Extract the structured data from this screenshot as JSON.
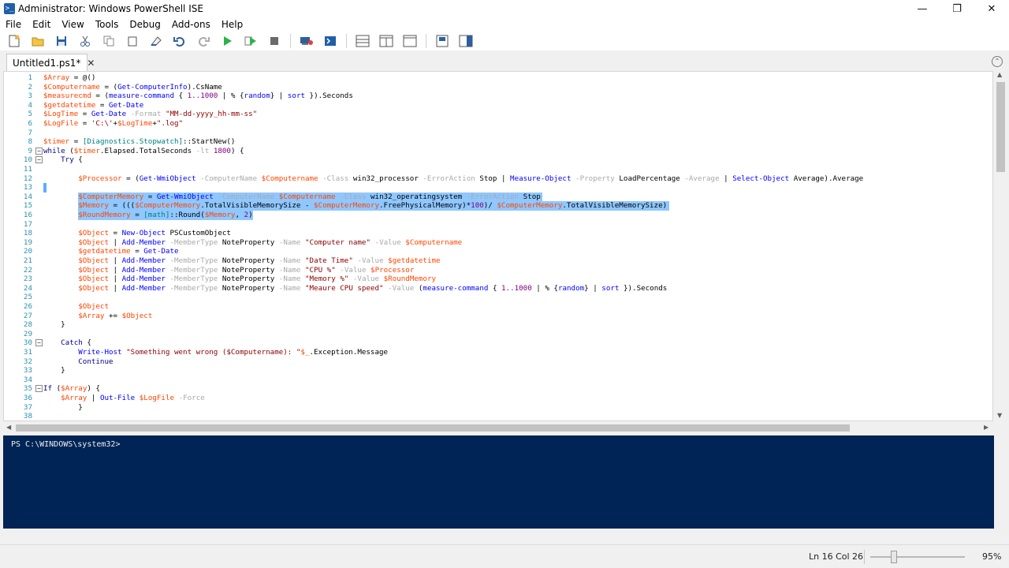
{
  "window": {
    "title": "Administrator: Windows PowerShell ISE",
    "icon_name": "powershell-ise-icon",
    "controls": [
      "minimize-icon",
      "restore-icon",
      "close-icon"
    ]
  },
  "menu": [
    "File",
    "Edit",
    "View",
    "Tools",
    "Debug",
    "Add-ons",
    "Help"
  ],
  "toolbar": {
    "buttons": [
      "new-file-icon",
      "open-file-icon",
      "save-icon",
      "cut-icon",
      "copy-icon",
      "paste-icon",
      "clear-console-icon",
      "undo-icon",
      "redo-icon",
      "run-script-icon",
      "run-selection-icon",
      "stop-icon",
      "remote-powershell-icon",
      "start-powershell-icon",
      "show-script-pane-top-icon",
      "show-script-pane-right-icon",
      "show-script-pane-max-icon",
      "show-command-window-icon",
      "show-command-addon-icon"
    ]
  },
  "tab": {
    "label": "Untitled1.ps1*"
  },
  "editor": {
    "lines": [
      "$Array = @()",
      "$Computername = (Get-ComputerInfo).CsName",
      "$measurecmd = (measure-command { 1..1000 | % {random} | sort }).Seconds",
      "$getdatetime = Get-Date",
      "$LogTime = Get-Date -Format \"MM-dd-yyyy_hh-mm-ss\"",
      "$LogFile = 'C:\\'+$LogTime+\".log\"",
      "",
      "$timer = [Diagnostics.Stopwatch]::StartNew()",
      "while ($timer.Elapsed.TotalSeconds -lt 1800) {",
      "    Try {",
      "",
      "        $Processor = (Get-WmiObject -ComputerName $Computername -Class win32_processor -ErrorAction Stop | Measure-Object -Property LoadPercentage -Average | Select-Object Average).Average",
      "",
      "        $ComputerMemory = Get-WmiObject -ComputerName $Computername -Class win32_operatingsystem -ErrorAction Stop",
      "        $Memory = ((($ComputerMemory.TotalVisibleMemorySize - $ComputerMemory.FreePhysicalMemory)*100)/ $ComputerMemory.TotalVisibleMemorySize)",
      "        $RoundMemory = [math]::Round($Memory, 2)",
      "",
      "        $Object = New-Object PSCustomObject",
      "        $Object | Add-Member -MemberType NoteProperty -Name \"Computer name\" -Value $Computername",
      "        $getdatetime = Get-Date",
      "        $Object | Add-Member -MemberType NoteProperty -Name \"Date Time\" -Value $getdatetime",
      "        $Object | Add-Member -MemberType NoteProperty -Name \"CPU %\" -Value $Processor",
      "        $Object | Add-Member -MemberType NoteProperty -Name \"Memory %\" -Value $RoundMemory",
      "        $Object | Add-Member -MemberType NoteProperty -Name \"Meaure CPU speed\" -Value (measure-command { 1..1000 | % {random} | sort }).Seconds",
      "",
      "        $Object",
      "        $Array += $Object",
      "    }",
      "",
      "    Catch {",
      "        Write-Host \"Something went wrong ($Computername): \"$_.Exception.Message",
      "        Continue",
      "    }",
      "",
      "If ($Array) {",
      "    $Array | Out-File $LogFile -Force",
      "        }",
      ""
    ],
    "selected_lines": [
      14,
      15,
      16
    ]
  },
  "console": {
    "prompt": "PS C:\\WINDOWS\\system32>"
  },
  "status": {
    "position": "Ln 16 Col 26",
    "zoom": "95%",
    "zoom_fraction": 0.25
  }
}
